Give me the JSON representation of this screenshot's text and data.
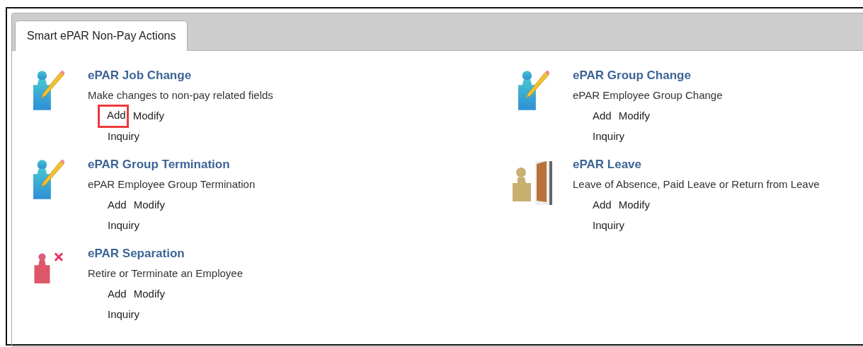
{
  "tabs": [
    {
      "label": "Smart ePAR Non-Pay Actions",
      "selected": true
    }
  ],
  "actions": [
    {
      "kind": "edit",
      "title": "ePAR Job Change",
      "description": "Make changes to non-pay related fields",
      "links": [
        {
          "label": "Add",
          "highlighted": true
        },
        {
          "label": "Modify",
          "highlighted": false
        },
        {
          "label": "Inquiry",
          "highlighted": false
        }
      ]
    },
    {
      "kind": "edit",
      "title": "ePAR Group Change",
      "description": "ePAR Employee Group Change",
      "links": [
        {
          "label": "Add",
          "highlighted": false
        },
        {
          "label": "Modify",
          "highlighted": false
        },
        {
          "label": "Inquiry",
          "highlighted": false
        }
      ]
    },
    {
      "kind": "edit",
      "title": "ePAR Group Termination",
      "description": "ePAR Employee Group Termination",
      "links": [
        {
          "label": "Add",
          "highlighted": false
        },
        {
          "label": "Modify",
          "highlighted": false
        },
        {
          "label": "Inquiry",
          "highlighted": false
        }
      ]
    },
    {
      "kind": "leave",
      "title": "ePAR Leave",
      "description": "Leave of Absence, Paid Leave or Return from Leave",
      "links": [
        {
          "label": "Add",
          "highlighted": false
        },
        {
          "label": "Modify",
          "highlighted": false
        },
        {
          "label": "Inquiry",
          "highlighted": false
        }
      ]
    },
    {
      "kind": "remove",
      "title": "ePAR Separation",
      "description": "Retire or Terminate an Employee",
      "links": [
        {
          "label": "Add",
          "highlighted": false
        },
        {
          "label": "Modify",
          "highlighted": false
        },
        {
          "label": "Inquiry",
          "highlighted": false
        }
      ]
    }
  ]
}
